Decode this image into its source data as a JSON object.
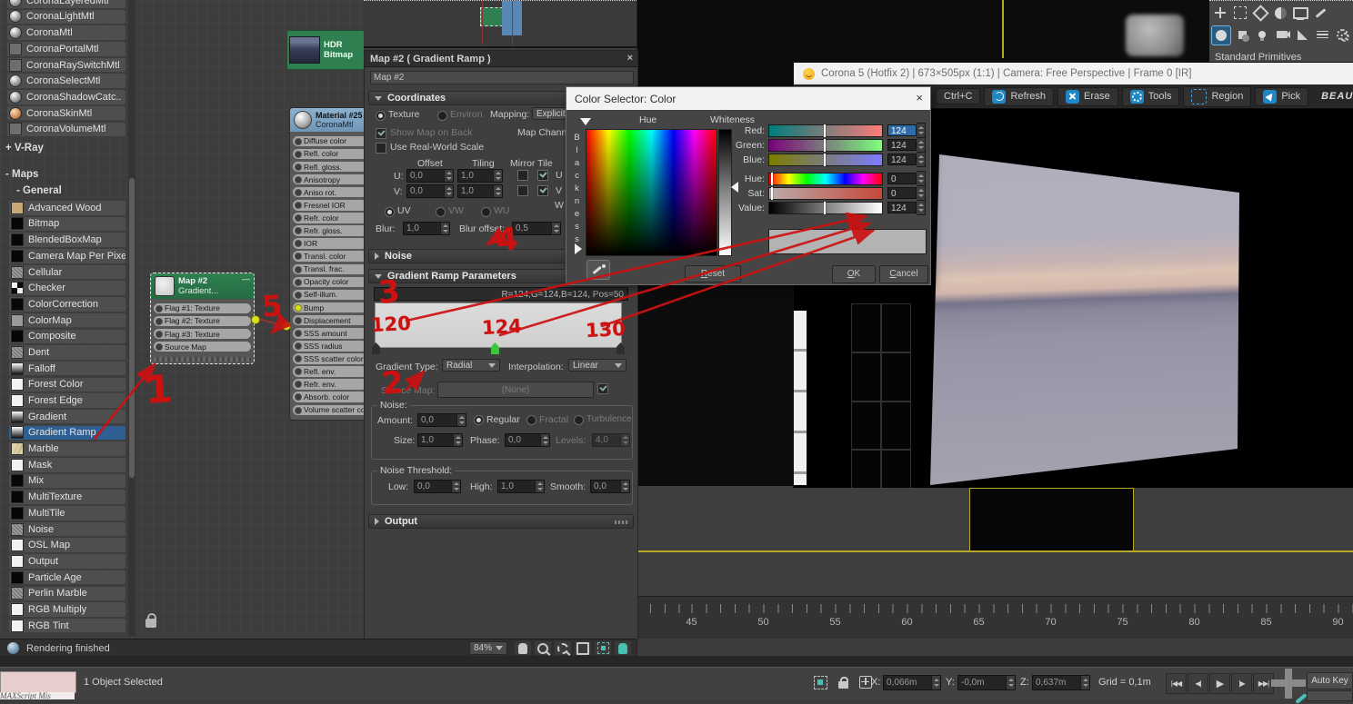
{
  "sidebar": {
    "corona_items": [
      {
        "label": "CoronaLayeredMtl",
        "cls": "sw-sphere"
      },
      {
        "label": "CoronaLightMtl",
        "cls": "sw-sphere"
      },
      {
        "label": "CoronaMtl",
        "cls": "sw-sphere"
      },
      {
        "label": "CoronaPortalMtl",
        "cls": "sw-flat"
      },
      {
        "label": "CoronaRaySwitchMtl",
        "cls": "sw-flat"
      },
      {
        "label": "CoronaSelectMtl",
        "cls": "sw-sphere"
      },
      {
        "label": "CoronaShadowCatc..",
        "cls": "sw-sphere"
      },
      {
        "label": "CoronaSkinMtl",
        "cls": "sw-sphere-tan"
      },
      {
        "label": "CoronaVolumeMtl",
        "cls": "sw-flat"
      }
    ],
    "vray_group": "+ V-Ray",
    "maps_group": "- Maps",
    "general_group": "- General",
    "map_items": [
      {
        "label": "Advanced Wood",
        "cls": "sw-tan"
      },
      {
        "label": "Bitmap",
        "cls": "sw-black"
      },
      {
        "label": "BlendedBoxMap",
        "cls": "sw-black"
      },
      {
        "label": "Camera Map Per Pixel",
        "cls": "sw-black"
      },
      {
        "label": "Cellular",
        "cls": "sw-noise"
      },
      {
        "label": "Checker",
        "cls": "sw-checker"
      },
      {
        "label": "ColorCorrection",
        "cls": "sw-black"
      },
      {
        "label": "ColorMap",
        "cls": "sw-gray"
      },
      {
        "label": "Composite",
        "cls": "sw-black"
      },
      {
        "label": "Dent",
        "cls": "sw-noise"
      },
      {
        "label": "Falloff",
        "cls": "sw-grad"
      },
      {
        "label": "Forest Color",
        "cls": "sw-white"
      },
      {
        "label": "Forest Edge",
        "cls": "sw-white"
      },
      {
        "label": "Gradient",
        "cls": "sw-grad"
      },
      {
        "label": "Gradient Ramp",
        "cls": "sw-grad selected"
      },
      {
        "label": "Marble",
        "cls": "sw-marble"
      },
      {
        "label": "Mask",
        "cls": "sw-white"
      },
      {
        "label": "Mix",
        "cls": "sw-black"
      },
      {
        "label": "MultiTexture",
        "cls": "sw-black"
      },
      {
        "label": "MultiTile",
        "cls": "sw-black"
      },
      {
        "label": "Noise",
        "cls": "sw-noise"
      },
      {
        "label": "OSL Map",
        "cls": "sw-white"
      },
      {
        "label": "Output",
        "cls": "sw-white"
      },
      {
        "label": "Particle Age",
        "cls": "sw-black"
      },
      {
        "label": "Perlin Marble",
        "cls": "sw-noise"
      },
      {
        "label": "RGB Multiply",
        "cls": "sw-white"
      },
      {
        "label": "RGB Tint",
        "cls": "sw-white"
      }
    ]
  },
  "slate_status": {
    "text": "Rendering finished",
    "zoom": "84%"
  },
  "nodes": {
    "hdr": {
      "line1": "HDR",
      "line2": "Bitmap"
    },
    "map2": {
      "title": "Map #2",
      "subtitle": "Gradient...",
      "collapse": "—",
      "inputs": [
        "Flag #1: Texture",
        "Flag #2: Texture",
        "Flag #3: Texture",
        "Source Map"
      ]
    },
    "material": {
      "title": "Material #25",
      "subtitle": "CoronaMtl",
      "slots": [
        "Diffuse color",
        "Refl. color",
        "Refl. gloss.",
        "Anisotropy",
        "Aniso rot.",
        "Fresnel IOR",
        "Refr. color",
        "Refr. gloss.",
        "IOR",
        "Transl. color",
        "Transl. frac.",
        "Opacity color",
        "Self-illum.",
        {
          "label": "Bump",
          "cls": "slot-active"
        },
        "Displacement",
        "SSS amount",
        "SSS radius",
        "SSS scatter color",
        "Refl. env.",
        "Refr. env.",
        "Absorb. color",
        "Volume scatter color"
      ]
    }
  },
  "panel": {
    "title": "Map #2  ( Gradient Ramp )",
    "close": "×",
    "name": "Map #2",
    "coordinates": {
      "header": "Coordinates",
      "texture": "Texture",
      "environ": "Environ",
      "mapping_label": "Mapping:",
      "mapping_value": "Explicit Map Ch",
      "show_map_back": "Show Map on Back",
      "map_channel": "Map Channel",
      "use_real_world": "Use Real-World Scale",
      "offset": "Offset",
      "tiling": "Tiling",
      "mirror_tile": "Mirror Tile",
      "u": "U:",
      "v": "V:",
      "u_offset": "0,0",
      "v_offset": "0,0",
      "u_tiling": "1,0",
      "v_tiling": "1,0",
      "axis_u": "U",
      "axis_v": "V",
      "axis_w": "W",
      "uv": "UV",
      "vw": "VW",
      "wu": "WU",
      "blur_label": "Blur:",
      "blur": "1,0",
      "blur_offset_label": "Blur offset:",
      "blur_offset": "0,5"
    },
    "noise_header": "Noise",
    "grp": {
      "header": "Gradient Ramp Parameters",
      "info": "R=124,G=124,B=124, Pos=50",
      "gradient_type_label": "Gradient Type:",
      "gradient_type": "Radial",
      "interpolation_label": "Interpolation:",
      "interpolation": "Linear",
      "source_map_label": "Source Map:",
      "source_map": "(None)",
      "noise_legend": "Noise:",
      "amount_label": "Amount:",
      "amount": "0,0",
      "regular": "Regular",
      "fractal": "Fractal",
      "turbulence": "Turbulence",
      "size_label": "Size:",
      "size": "1,0",
      "phase_label": "Phase:",
      "phase": "0,0",
      "levels_label": "Levels:",
      "levels": "4,0",
      "threshold_legend": "Noise Threshold:",
      "low_label": "Low:",
      "low": "0,0",
      "high_label": "High:",
      "high": "1,0",
      "smooth_label": "Smooth:",
      "smooth": "0,0"
    },
    "output_header": "Output"
  },
  "color_selector": {
    "title": "Color Selector: Color",
    "close": "×",
    "hue": "Hue",
    "whiteness": "Whiteness",
    "blackness": "Blackness",
    "rows": [
      {
        "label": "Red:",
        "value": "124",
        "cls": "sl-red sel"
      },
      {
        "label": "Green:",
        "value": "124",
        "cls": "sl-green"
      },
      {
        "label": "Blue:",
        "value": "124",
        "cls": "sl-blue"
      },
      {
        "label": "Hue:",
        "value": "0",
        "cls": "sl-hue mk0 gap"
      },
      {
        "label": "Sat:",
        "value": "0",
        "cls": "sl-sat mk0"
      },
      {
        "label": "Value:",
        "value": "124",
        "cls": "sl-val"
      }
    ],
    "reset": "Reset",
    "ok": "OK",
    "cancel": "Cancel"
  },
  "vfb": {
    "title": "Corona 5 (Hotfix 2) | 673×505px (1:1) | Camera: Free Perspective | Frame 0 [IR]",
    "copy": "Ctrl+C",
    "refresh": "Refresh",
    "erase": "Erase",
    "tools": "Tools",
    "region": "Region",
    "pick": "Pick",
    "pass": "BEAUTY"
  },
  "command_panel": {
    "category": "Standard Primitives"
  },
  "timeline": {
    "labels": [
      "45",
      "50",
      "55",
      "60",
      "65",
      "70",
      "75",
      "80",
      "85",
      "90"
    ]
  },
  "status": {
    "selection": "1 Object Selected",
    "x_label": "X:",
    "x": "0,066m",
    "y_label": "Y:",
    "y": "-0,0m",
    "z_label": "Z:",
    "z": "0,637m",
    "grid": "Grid = 0,1m",
    "auto_key": "Auto Key",
    "maxscript": "MAXScript Mis",
    "transport": {
      "start": "|◀◀",
      "prev": "◀|",
      "play": "▶",
      "next": "|▶",
      "end": "▶▶|"
    }
  },
  "annotations": {
    "n1": "1",
    "n2": "2",
    "n3": "3",
    "n4": "4",
    "n5": "5",
    "v120": "120",
    "v124": "124",
    "v130": "130"
  },
  "colors": {
    "annotation_red": "#cc1111",
    "selection_blue": "#2f5e92",
    "node_green": "#2f8050",
    "material_header_blue": "#7fa6c5",
    "connector_yellow": "#d9e021",
    "vfb_accent_blue": "#1e88c7",
    "viewport_yellow": "#b8a825",
    "teal_accent": "#49c0b6",
    "swatch_gray": "#b3b3b3"
  }
}
